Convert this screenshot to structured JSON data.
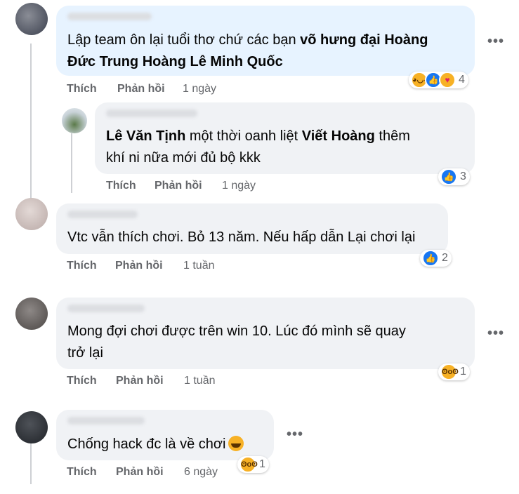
{
  "actions": {
    "like": "Thích",
    "reply": "Phản hồi"
  },
  "comments": [
    {
      "text_parts": [
        "Lập team ôn lại tuổi thơ chứ các bạn ",
        "võ hưng đại Hoàng",
        "Đức Trung Hoàng Lê Minh Quốc"
      ],
      "time": "1 ngày",
      "reaction_count": "4",
      "reaction_icons": [
        "haha-icon",
        "like-icon",
        "care-icon"
      ]
    },
    {
      "line1": [
        "Lê Văn Tịnh",
        " một thời oanh liệt ",
        "Viết Hoàng",
        " thêm"
      ],
      "line2": "khí ni nữa mới đủ bộ kkk",
      "time": "1 ngày",
      "reaction_count": "3",
      "reaction_icons": [
        "like-icon"
      ]
    },
    {
      "text": "Vtc vẫn thích chơi. Bỏ 13 năm. Nếu hấp dẫn Lại chơi lại",
      "time": "1 tuần",
      "reaction_count": "2",
      "reaction_icons": [
        "like-icon"
      ]
    },
    {
      "line1": "Mong đợi chơi được trên win 10. Lúc đó mình sẽ quay",
      "line2": "trở lại",
      "time": "1 tuần",
      "reaction_count": "1",
      "reaction_icons": [
        "wow-icon"
      ]
    },
    {
      "text": "Chống hack đc là về chơi",
      "emoji": "laughing-crying-emoji",
      "time": "6 ngày",
      "reaction_count": "1",
      "reaction_icons": [
        "wow-icon"
      ]
    }
  ],
  "more_label": "•••",
  "colors": {
    "bubble_blue": "#e7f3ff",
    "bubble_gray": "#f0f2f5",
    "meta_gray": "#65676b",
    "like_blue": "#1877f2",
    "emoji_yellow": "#f7b125"
  }
}
